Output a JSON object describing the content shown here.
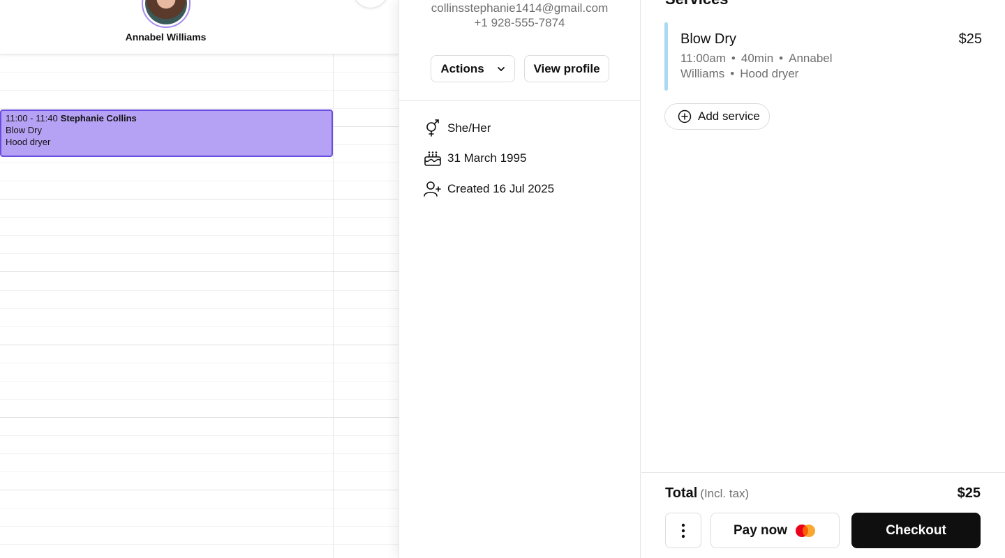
{
  "calendar": {
    "staff_name": "Annabel Williams",
    "appointment": {
      "time": "11:00 - 11:40",
      "client": "Stephanie Collins",
      "service": "Blow Dry",
      "resource": "Hood dryer",
      "color": "#b6a2f4",
      "border_color": "#6a4de0"
    }
  },
  "client": {
    "email": "collinsstephanie1414@gmail.com",
    "phone": "+1 928-555-7874",
    "actions_label": "Actions",
    "view_profile_label": "View profile",
    "pronouns": "She/Her",
    "birthday": "31 March 1995",
    "created": "Created 16 Jul 2025",
    "icons": [
      "gender-icon",
      "birthday-cake-icon",
      "user-added-icon",
      "chevron-down-icon"
    ]
  },
  "services": {
    "title": "Services",
    "items": [
      {
        "name": "Blow Dry",
        "price": "$25",
        "time": "11:00am",
        "duration": "40min",
        "staff": "Annabel Williams",
        "resource": "Hood dryer",
        "color": "#a9daf0"
      }
    ],
    "add_service_label": "Add service",
    "total_label": "Total",
    "total_note": "(Incl. tax)",
    "total_price": "$25",
    "pay_now_label": "Pay now",
    "checkout_label": "Checkout"
  }
}
